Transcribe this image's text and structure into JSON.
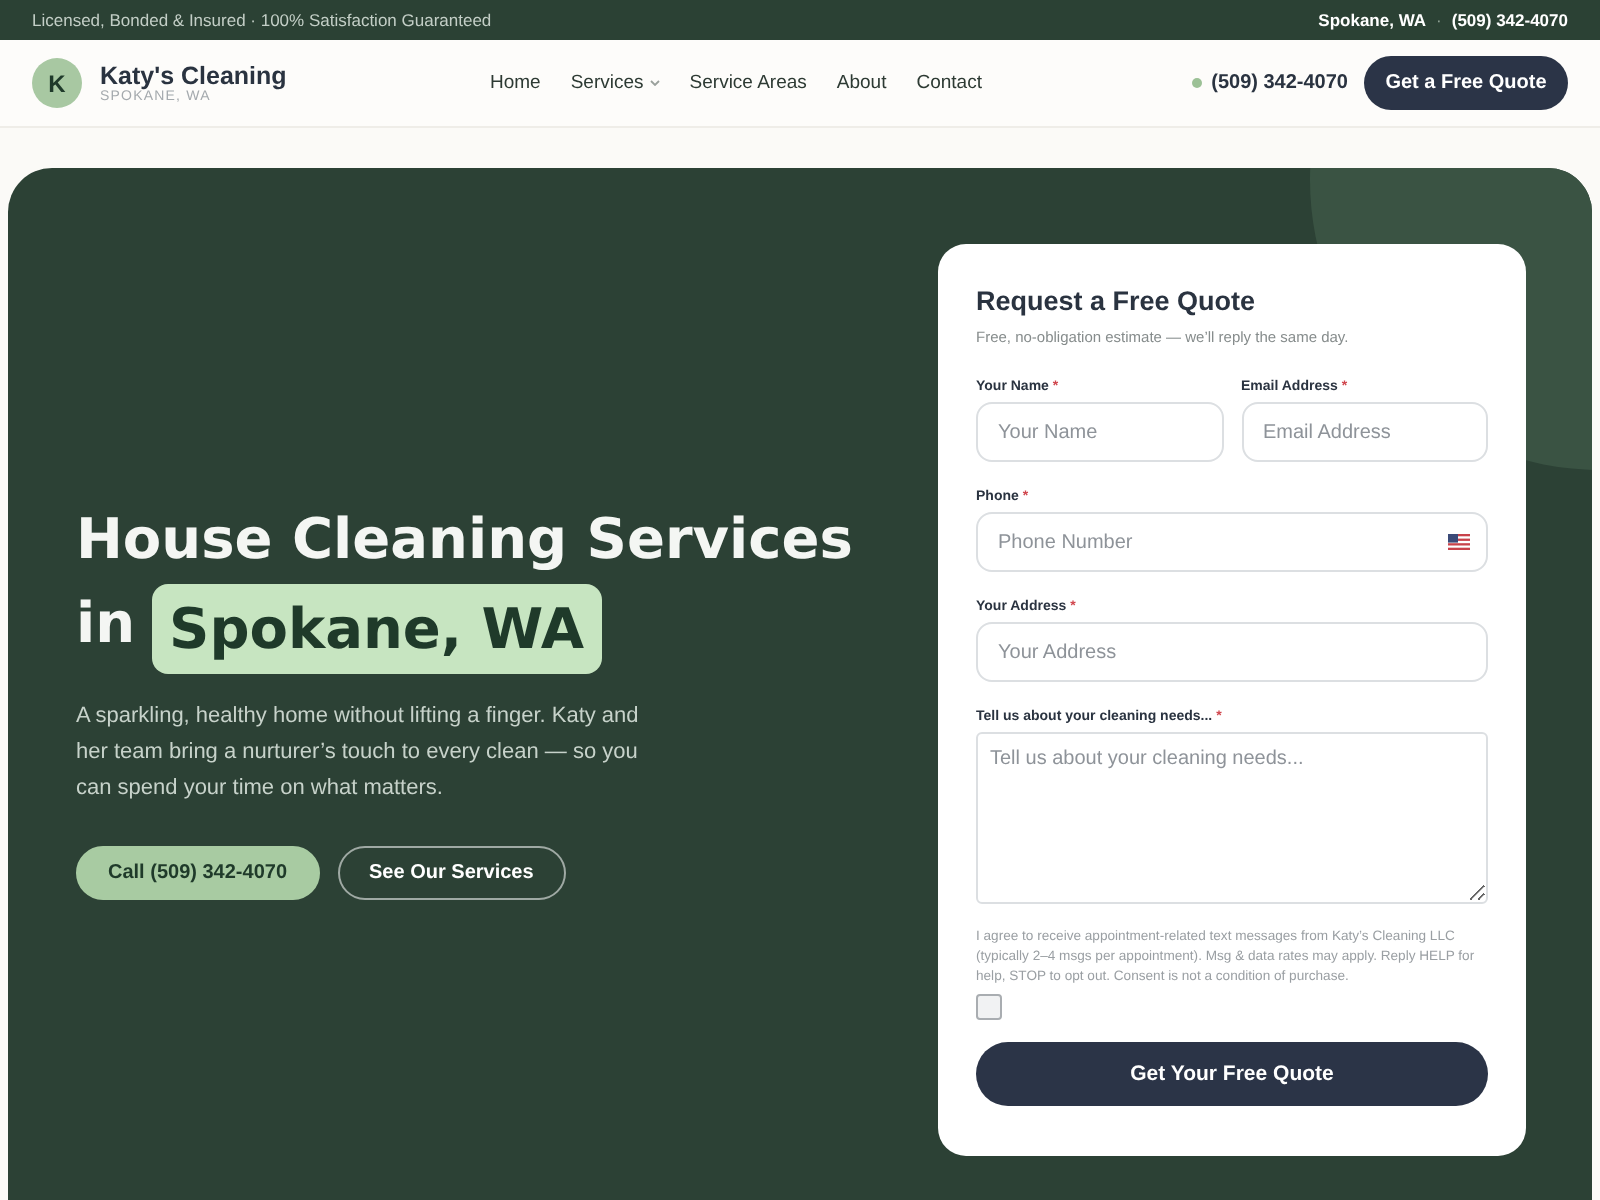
{
  "top_bar": {
    "tagline": "Licensed, Bonded & Insured · 100% Satisfaction Guaranteed",
    "location": "Spokane, WA",
    "separator": "·",
    "phone": "(509) 342-4070"
  },
  "header": {
    "logo": {
      "initial": "K",
      "name": "Katy's Cleaning",
      "tagline": "SPOKANE, WA"
    },
    "nav": [
      {
        "label": "Home",
        "dropdown": false
      },
      {
        "label": "Services",
        "dropdown": true
      },
      {
        "label": "Service Areas",
        "dropdown": false
      },
      {
        "label": "About",
        "dropdown": false
      },
      {
        "label": "Contact",
        "dropdown": false
      }
    ],
    "phone": "(509) 342-4070",
    "cta": "Get a Free Quote"
  },
  "hero": {
    "title": "House Cleaning Services",
    "title_prefix": "in",
    "highlight": "Spokane, WA",
    "text": "A sparkling, healthy home without lifting a finger. Katy and her team bring a nurturer’s touch to every clean — so you can spend your time on what matters.",
    "buttons": [
      {
        "kind": "primary",
        "label": "Call (509) 342-4070"
      },
      {
        "kind": "outline",
        "label": "See Our Services"
      }
    ]
  },
  "quote_form": {
    "title": "Request a Free Quote",
    "subtitle": "Free, no-obligation estimate — we’ll reply the same day.",
    "rows": [
      [
        {
          "kind": "text",
          "label": "Your Name",
          "required_mark": "*",
          "placeholder": "Your Name"
        },
        {
          "kind": "text",
          "label": "Email Address",
          "required_mark": "*",
          "placeholder": "Email Address"
        }
      ],
      [
        {
          "kind": "phone",
          "label": "Phone",
          "required_mark": "*",
          "placeholder": "Phone Number"
        }
      ],
      [
        {
          "kind": "text",
          "label": "Your Address",
          "required_mark": "*",
          "placeholder": "Your Address"
        }
      ],
      [
        {
          "kind": "textarea",
          "label": "Tell us about your cleaning needs...",
          "required_mark": "*",
          "placeholder": "Tell us about your cleaning needs..."
        }
      ]
    ],
    "consent": {
      "text": "I agree to receive appointment-related text messages from Katy’s Cleaning LLC (typically 2–4 msgs per appointment). Msg & data rates may apply. Reply HELP for help, STOP to opt out. Consent is not a condition of purchase.",
      "checked": false
    },
    "submit": "Get Your Free Quote"
  }
}
